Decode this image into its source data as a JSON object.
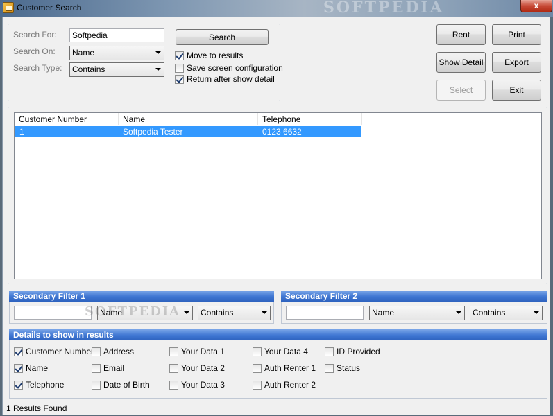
{
  "window": {
    "title": "Customer Search",
    "close_label": "x",
    "watermark": "SOFTPEDIA"
  },
  "search": {
    "search_for_label": "Search For:",
    "search_on_label": "Search On:",
    "search_type_label": "Search Type:",
    "search_for_value": "Softpedia",
    "search_on_value": "Name",
    "search_type_value": "Contains",
    "search_button": "Search",
    "options": [
      {
        "label": "Move to results",
        "checked": true
      },
      {
        "label": "Save screen configuration",
        "checked": false
      },
      {
        "label": "Return after show detail",
        "checked": true
      }
    ]
  },
  "actions": {
    "rent": "Rent",
    "print": "Print",
    "show_detail": "Show Detail",
    "export": "Export",
    "select": "Select",
    "exit": "Exit"
  },
  "results": {
    "columns": [
      "Customer Number",
      "Name",
      "Telephone"
    ],
    "rows": [
      {
        "customer_number": "1",
        "name": "Softpedia Tester",
        "telephone": "0123 6632"
      }
    ]
  },
  "filter1": {
    "title": "Secondary Filter 1",
    "value": "",
    "field": "Name",
    "type": "Contains",
    "watermark": "SOFTPEDIA"
  },
  "filter2": {
    "title": "Secondary Filter 2",
    "value": "",
    "field": "Name",
    "type": "Contains"
  },
  "details": {
    "title": "Details to show in results",
    "items": [
      {
        "label": "Customer Number",
        "checked": true
      },
      {
        "label": "Name",
        "checked": true
      },
      {
        "label": "Telephone",
        "checked": true
      },
      {
        "label": "Address",
        "checked": false
      },
      {
        "label": "Email",
        "checked": false
      },
      {
        "label": "Date of Birth",
        "checked": false
      },
      {
        "label": "Your Data 1",
        "checked": false
      },
      {
        "label": "Your Data 2",
        "checked": false
      },
      {
        "label": "Your Data 3",
        "checked": false
      },
      {
        "label": "Your Data 4",
        "checked": false
      },
      {
        "label": "Auth Renter 1",
        "checked": false
      },
      {
        "label": "Auth Renter 2",
        "checked": false
      },
      {
        "label": "ID Provided",
        "checked": false
      },
      {
        "label": "Status",
        "checked": false
      }
    ]
  },
  "status": {
    "text": "1 Results Found"
  },
  "colors": {
    "selection": "#3399ff",
    "section_bar": "#3f76d2",
    "title_close": "#c74a37"
  }
}
